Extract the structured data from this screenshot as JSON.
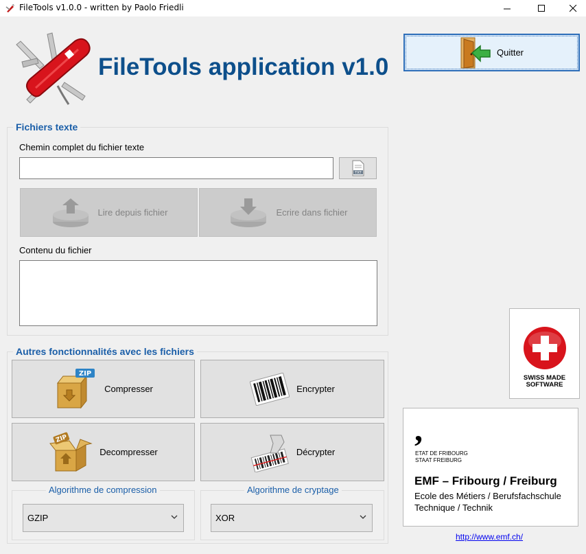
{
  "window": {
    "title": "FileTools v1.0.0 - written by Paolo Friedli"
  },
  "header": {
    "title": "FileTools application v1.0",
    "logo_icon": "swiss-army-knife-icon"
  },
  "quit": {
    "label": "Quitter",
    "icon": "exit-door-icon"
  },
  "text_files": {
    "group_title": "Fichiers texte",
    "path_label": "Chemin complet du fichier texte",
    "path_value": "",
    "browse_icon": "txt-file-icon",
    "read_label": "Lire depuis fichier",
    "write_label": "Ecrire dans fichier",
    "content_label": "Contenu du fichier",
    "content_value": ""
  },
  "other": {
    "group_title": "Autres fonctionnalités avec les fichiers",
    "compress_label": "Compresser",
    "encrypt_label": "Encrypter",
    "decompress_label": "Decompresser",
    "decrypt_label": "Décrypter",
    "zip_badge": "ZIP",
    "compression_algo_label": "Algorithme de compression",
    "compression_algo_value": "GZIP",
    "crypto_algo_label": "Algorithme de cryptage",
    "crypto_algo_value": "XOR"
  },
  "swiss_badge": {
    "line1": "SWISS MADE",
    "line2": "SOFTWARE"
  },
  "emf_logo": {
    "mark": ",",
    "line1": "ETAT DE FRIBOURG",
    "line2": "STAAT FREIBURG",
    "name": "EMF – Fribourg / Freiburg",
    "sub1": "Ecole des Métiers / Berufsfachschule",
    "sub2": "Technique / Technik"
  },
  "link": {
    "text": "http://www.emf.ch/"
  },
  "colors": {
    "title_blue": "#0d4f8b",
    "group_blue": "#1a5ea8",
    "swiss_red": "#d8141c",
    "quit_border": "#2b6cb8"
  }
}
